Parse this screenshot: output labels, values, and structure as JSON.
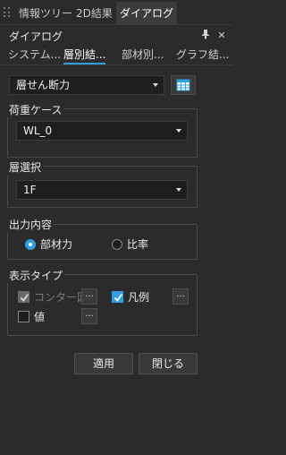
{
  "doc_tabs": [
    {
      "label": "情報ツリー"
    },
    {
      "label": "2D結果"
    },
    {
      "label": "ダイアログ"
    }
  ],
  "panel": {
    "title": "ダイアログ",
    "pin_icon": "pin-icon",
    "close_icon": "close-icon"
  },
  "sub_tabs": [
    {
      "label": "システム..."
    },
    {
      "label": "層別結..."
    },
    {
      "label": "部材別..."
    },
    {
      "label": "グラフ結..."
    }
  ],
  "main_select": {
    "value": "層せん断力"
  },
  "table_button": {
    "icon": "table-icon",
    "accent": "#2f9fe0"
  },
  "load_case": {
    "label": "荷重ケース",
    "value": "WL_0"
  },
  "floor": {
    "label": "層選択",
    "value": "1F"
  },
  "output": {
    "label": "出力内容",
    "options": [
      {
        "label": "部材力",
        "checked": true
      },
      {
        "label": "比率",
        "checked": false
      }
    ]
  },
  "display_type": {
    "label": "表示タイプ",
    "contour": {
      "label": "コンター図",
      "checked": true,
      "disabled": true
    },
    "legend": {
      "label": "凡例",
      "checked": true
    },
    "value": {
      "label": "値",
      "checked": false
    },
    "more_label": "..."
  },
  "actions": {
    "apply": "適用",
    "close": "閉じる"
  },
  "colors": {
    "accent": "#2f9fe0",
    "background": "#2b2b2b",
    "field": "#1e1e1e"
  }
}
